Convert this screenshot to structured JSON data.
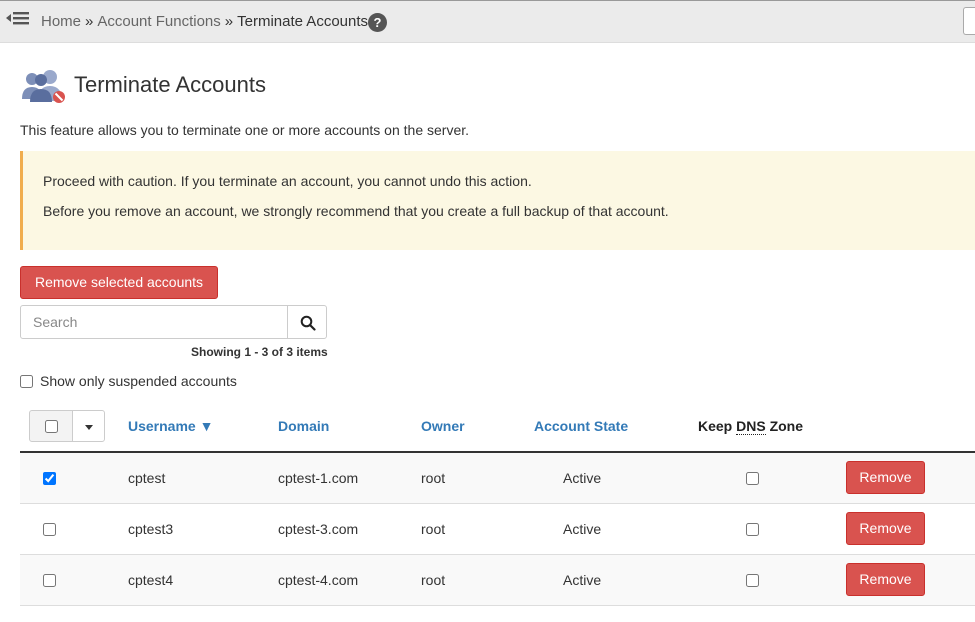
{
  "breadcrumb": {
    "home": "Home",
    "sep": "»",
    "section": "Account Functions",
    "current": "Terminate Accounts"
  },
  "help_icon": "?",
  "page": {
    "title": "Terminate Accounts",
    "description": "This feature allows you to terminate one or more accounts on the server."
  },
  "warning": {
    "line1": "Proceed with caution. If you terminate an account, you cannot undo this action.",
    "line2": "Before you remove an account, we strongly recommend that you create a full backup of that account."
  },
  "actions": {
    "remove_selected_label": "Remove selected accounts"
  },
  "search": {
    "placeholder": "Search",
    "value": ""
  },
  "paging": {
    "showing": "Showing 1 - 3 of 3 items"
  },
  "filter": {
    "suspended_label": "Show only suspended accounts",
    "checked": false
  },
  "table": {
    "headers": {
      "username": "Username ▼",
      "domain": "Domain",
      "owner": "Owner",
      "state": "Account State",
      "keep_prefix": "Keep ",
      "keep_abbr": "DNS",
      "keep_suffix": " Zone"
    },
    "rows": [
      {
        "checked": true,
        "username": "cptest",
        "domain": "cptest-1.com",
        "owner": "root",
        "state": "Active",
        "keep_dns": false,
        "action": "Remove"
      },
      {
        "checked": false,
        "username": "cptest3",
        "domain": "cptest-3.com",
        "owner": "root",
        "state": "Active",
        "keep_dns": false,
        "action": "Remove"
      },
      {
        "checked": false,
        "username": "cptest4",
        "domain": "cptest-4.com",
        "owner": "root",
        "state": "Active",
        "keep_dns": false,
        "action": "Remove"
      }
    ]
  },
  "colors": {
    "danger": "#d9534f",
    "link": "#337ab7",
    "warning_bg": "#fcf8e3",
    "warning_border": "#f0ad4e"
  },
  "icons": {
    "menu": "menu-collapse-icon",
    "help": "help-icon",
    "page": "users-terminate-icon",
    "search": "search-icon"
  }
}
